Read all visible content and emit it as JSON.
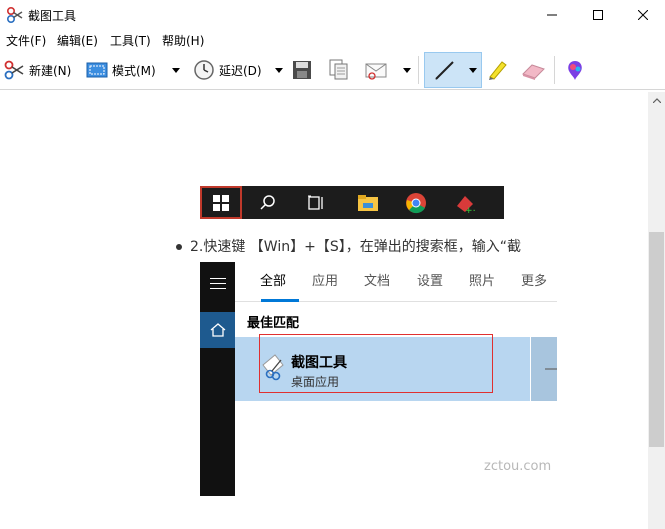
{
  "window": {
    "title": "截图工具",
    "minimize": "minimize",
    "maximize": "maximize",
    "close": "close"
  },
  "menu": {
    "file": "文件(F)",
    "edit": "编辑(E)",
    "tools": "工具(T)",
    "help": "帮助(H)"
  },
  "toolbar": {
    "new_label": "新建(N)",
    "mode_label": "模式(M)",
    "delay_label": "延迟(D)"
  },
  "content": {
    "bullet_text": "2.快速键 【Win】+【S】，在弹出的搜索框，输入“截",
    "search_tabs": [
      "全部",
      "应用",
      "文档",
      "设置",
      "照片",
      "更多"
    ],
    "best_match": "最佳匹配",
    "result_title": "截图工具",
    "result_subtitle": "桌面应用",
    "watermark": "zctou.com"
  },
  "colors": {
    "accent": "#0078d7",
    "selection": "#b8d6f0",
    "highlight_box": "#e03030",
    "taskbar": "#1c1c1c"
  }
}
